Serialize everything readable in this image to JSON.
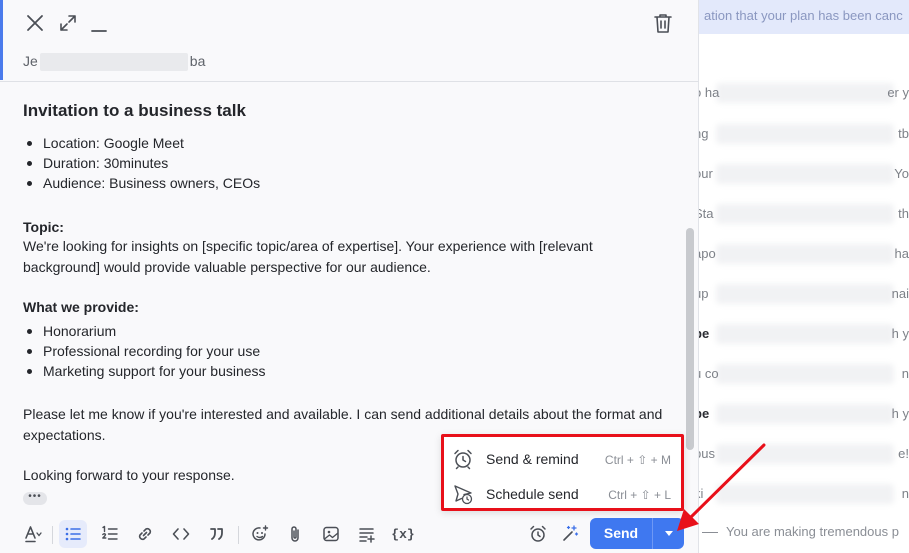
{
  "background": {
    "banner_text": "ation that your plan has been canc",
    "rows": [
      {
        "left": "o ha",
        "right": "er y",
        "bold": false
      },
      {
        "left": "ng",
        "right": "tb",
        "bold": false
      },
      {
        "left": "our",
        "right": "Yo",
        "bold": false
      },
      {
        "left": "Sta",
        "right": "th",
        "bold": false
      },
      {
        "left": "apo",
        "right": "ha",
        "bold": false
      },
      {
        "left": "up",
        "right": "nai",
        "bold": false
      },
      {
        "left": "pe",
        "right": "h y",
        "bold": true
      },
      {
        "left": "u co",
        "right": "n",
        "bold": false
      },
      {
        "left": "pe",
        "right": "h y",
        "bold": true
      },
      {
        "left": "pus",
        "right": "e!",
        "bold": false
      },
      {
        "left": "ki",
        "right": "n",
        "bold": false
      }
    ],
    "bottom_text": "You are making tremendous p"
  },
  "compose": {
    "recipient_prefix": "Je",
    "recipient_suffix": "ba",
    "subject": "Invitation to a business talk",
    "details": [
      "Location: Google Meet",
      "Duration: 30minutes",
      "Audience: Business owners, CEOs"
    ],
    "topic_heading": "Topic:",
    "topic_text": "We're looking for insights on [specific topic/area of expertise]. Your experience with [relevant background] would provide valuable perspective for our audience.",
    "provide_heading": "What we provide:",
    "provide_items": [
      "Honorarium",
      "Professional recording for your use",
      "Marketing support for your business"
    ],
    "closing_text": "Please let me know if you're interested and available. I can send additional details about the format and expectations.",
    "signoff": "Looking forward to your response.",
    "ellipsis": "•••"
  },
  "toolbar": {
    "code_label": "<>",
    "quote_label": "99",
    "variable_label": "{x}",
    "send_label": "Send"
  },
  "send_menu": {
    "items": [
      {
        "label": "Send & remind",
        "shortcut": "Ctrl + ⇧ + M",
        "icon": "alarm-clock-icon"
      },
      {
        "label": "Schedule send",
        "shortcut": "Ctrl + ⇧ + L",
        "icon": "schedule-send-icon"
      }
    ]
  },
  "colors": {
    "accent": "#3f78f0",
    "annotation": "#e8101a"
  }
}
